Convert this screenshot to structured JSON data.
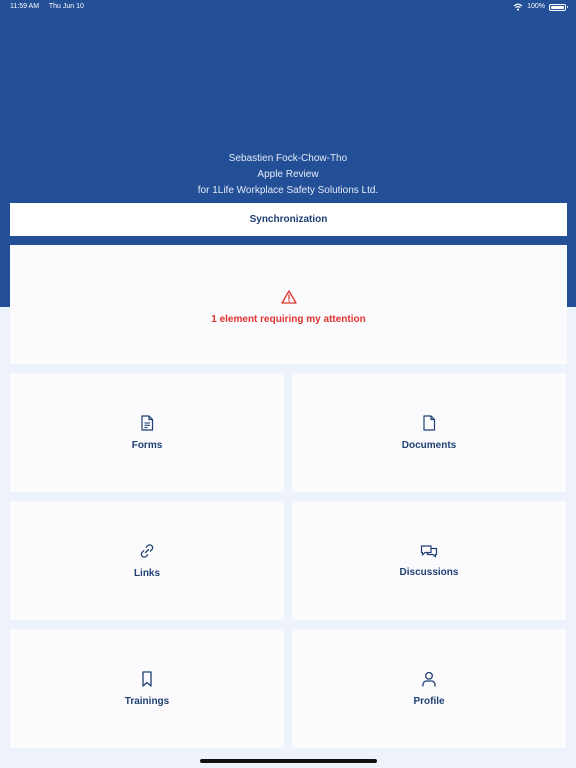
{
  "status_bar": {
    "time": "11:59 AM",
    "date": "Thu Jun 10",
    "battery": "100%",
    "wifi_icon": "wifi-icon",
    "battery_icon": "battery-icon"
  },
  "user": {
    "name": "Sebastien Fock-Chow-Tho",
    "role": "Apple Review",
    "company": "for 1Life Workplace Safety Solutions Ltd."
  },
  "sync": {
    "label": "Synchronization"
  },
  "attention": {
    "icon": "warning-triangle-icon",
    "text": "1 element requiring my attention",
    "color": "#e0332e"
  },
  "tiles": [
    {
      "label": "Forms",
      "icon": "form-document-icon"
    },
    {
      "label": "Documents",
      "icon": "document-icon"
    },
    {
      "label": "Links",
      "icon": "link-icon"
    },
    {
      "label": "Discussions",
      "icon": "chat-bubbles-icon"
    },
    {
      "label": "Trainings",
      "icon": "bookmark-icon"
    },
    {
      "label": "Profile",
      "icon": "user-icon"
    }
  ],
  "colors": {
    "header_background": "#234f97",
    "page_background": "#eef2fb",
    "accent_text": "#1f3f73",
    "alert": "#e0332e"
  }
}
